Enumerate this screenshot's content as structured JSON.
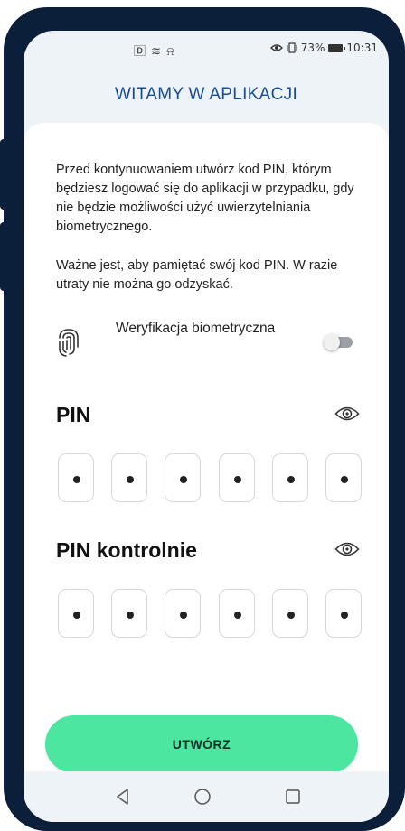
{
  "status_bar": {
    "left_icons": [
      "sim-icon",
      "wifi-icon",
      "nfc-icon"
    ],
    "left_text": "🄳 ≋ ⍾",
    "battery": "73%",
    "time": "10:31"
  },
  "header": {
    "title": "WITAMY W APLIKACJI"
  },
  "intro": {
    "paragraph1": "Przed kontynuowaniem utwórz kod PIN, którym będziesz logować się do aplikacji w przypadku, gdy nie będzie możliwości użyć uwierzytelniania biometrycznego.",
    "paragraph2": "Ważne jest, aby pamiętać swój kod PIN. W razie utraty nie można go odzyskać."
  },
  "biometric": {
    "label": "Weryfikacja biometryczna",
    "enabled": false
  },
  "pin": {
    "label": "PIN",
    "digits": [
      "•",
      "•",
      "•",
      "•",
      "•",
      "•"
    ]
  },
  "pin_confirm": {
    "label": "PIN kontrolnie",
    "digits": [
      "•",
      "•",
      "•",
      "•",
      "•",
      "•"
    ]
  },
  "actions": {
    "create_label": "UTWÓRZ"
  },
  "colors": {
    "accent": "#4de6a1",
    "title": "#1a4d8f",
    "frame": "#0b1f3a"
  }
}
